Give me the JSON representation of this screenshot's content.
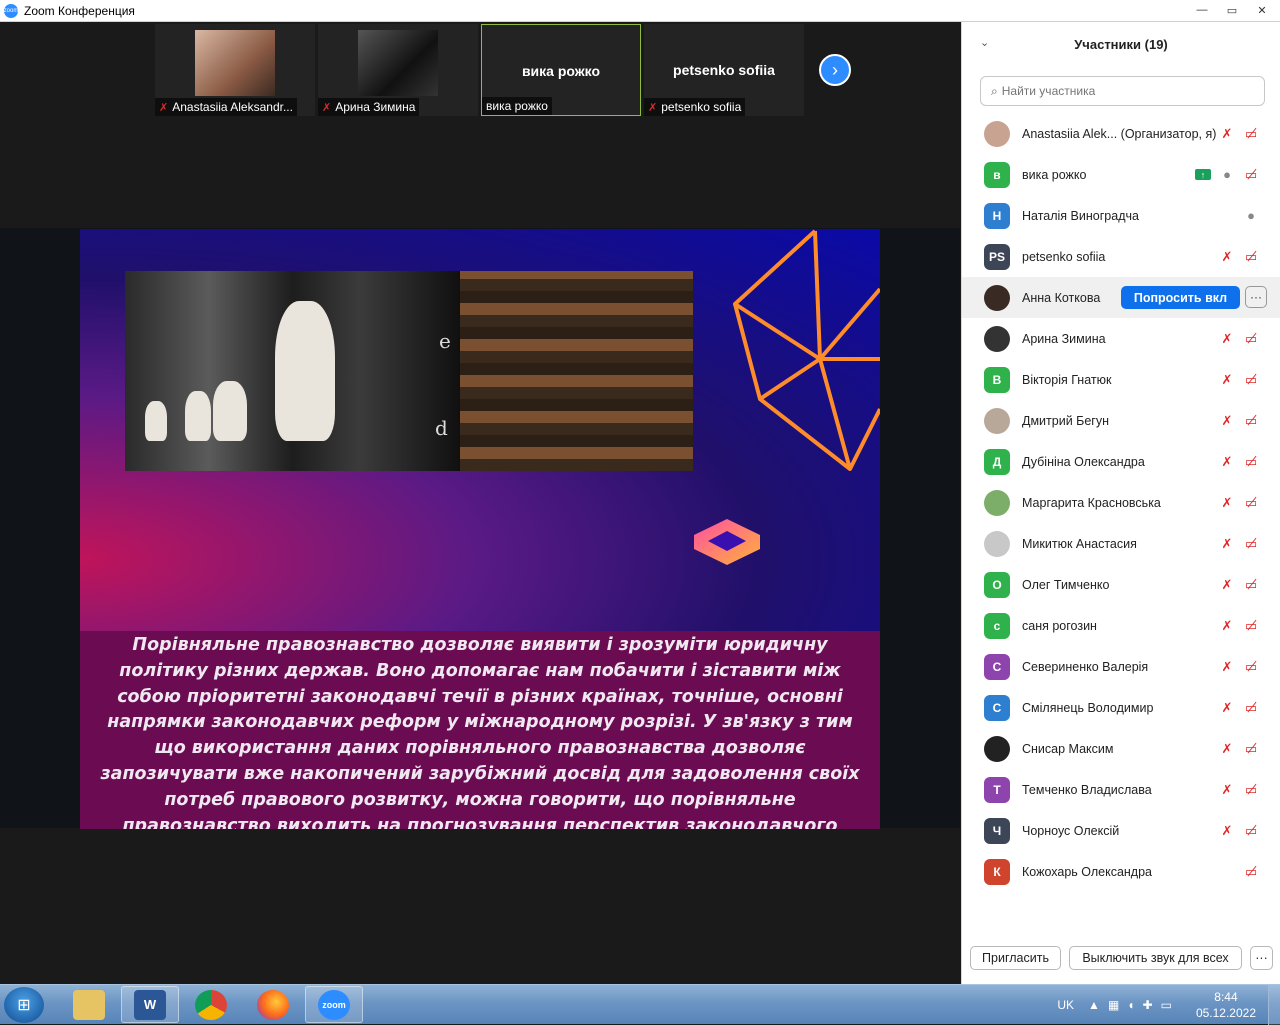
{
  "window": {
    "title": "Zoom Конференция",
    "logo_text": "zoom",
    "min": "—",
    "max": "▭",
    "close": "✕"
  },
  "thumbnails": [
    {
      "label": "Anastasiia Aleksandr...",
      "has_photo": true,
      "muted": true
    },
    {
      "label": "Арина Зимина",
      "has_photo": true,
      "muted": true
    },
    {
      "label": "вика рожко",
      "center_name": "вика рожко",
      "muted": false,
      "active": true
    },
    {
      "label": "petsenko sofiia",
      "center_name": "petsenko sofiia",
      "muted": true
    }
  ],
  "next_arrow": "›",
  "slide": {
    "letters": [
      "e",
      "d"
    ],
    "caption": "Порівняльне правознавство дозволяє виявити і зрозуміти юридичну політику різних держав. Воно допомагає нам побачити і зіставити між собою пріоритетні законодавчі течії в різних країнах, точніше, основні напрямки законодавчих реформ у міжнародному розрізі. У зв'язку з тим що використання даних порівняльного правознавства дозволяє запозичувати вже накопичений зарубіжний досвід для задоволення своїх потреб правового розвитку, можна говорити, що порівняльне правознавство виходить на прогнозування перспектив законодавчого розвитку."
  },
  "panel": {
    "title": "Участники (19)",
    "collapse_icon": "⌄",
    "search_placeholder": "Найти участника",
    "participants": [
      {
        "name": "Anastasiia Alek... (Организатор, я)",
        "avatar": "",
        "color": "#c9a391",
        "photo": true,
        "icons": [
          "mic-off",
          "video-off"
        ]
      },
      {
        "name": "вика рожко",
        "avatar": "в",
        "color": "#2fb24c",
        "icons": [
          "share",
          "mic",
          "video-off"
        ]
      },
      {
        "name": "Наталія Виноградча",
        "avatar": "Н",
        "color": "#2f7fd1",
        "icons": [
          "mic"
        ]
      },
      {
        "name": "petsenko sofiia",
        "avatar": "PS",
        "color": "#3d4657",
        "icons": [
          "mic-off",
          "video-off"
        ]
      },
      {
        "name": "Анна Коткова",
        "avatar": "",
        "color": "#3a2a24",
        "photo": true,
        "icons": [],
        "hover": true
      },
      {
        "name": "Арина Зимина",
        "avatar": "",
        "color": "#333333",
        "photo": true,
        "icons": [
          "mic-off",
          "video-off"
        ]
      },
      {
        "name": "Вікторія Гнатюк",
        "avatar": "В",
        "color": "#2fb24c",
        "icons": [
          "mic-off",
          "video-off"
        ]
      },
      {
        "name": "Дмитрий Бегун",
        "avatar": "",
        "color": "#b8a89a",
        "photo": true,
        "icons": [
          "mic-off",
          "video-off"
        ]
      },
      {
        "name": "Дубініна Олександра",
        "avatar": "Д",
        "color": "#2fb24c",
        "icons": [
          "mic-off",
          "video-off"
        ]
      },
      {
        "name": "Маргарита Красновська",
        "avatar": "",
        "color": "#7cae6a",
        "photo": true,
        "icons": [
          "mic-off",
          "video-off"
        ]
      },
      {
        "name": "Микитюк Анастасия",
        "avatar": "",
        "color": "#c8c8c8",
        "photo": true,
        "icons": [
          "mic-off",
          "video-off"
        ]
      },
      {
        "name": "Олег Тимченко",
        "avatar": "О",
        "color": "#2fb24c",
        "icons": [
          "mic-off",
          "video-off"
        ]
      },
      {
        "name": "саня рогозин",
        "avatar": "с",
        "color": "#2fb24c",
        "icons": [
          "mic-off",
          "video-off"
        ]
      },
      {
        "name": "Севериненко Валерія",
        "avatar": "С",
        "color": "#8e44ad",
        "icons": [
          "mic-off",
          "video-off"
        ]
      },
      {
        "name": "Смілянець Володимир",
        "avatar": "С",
        "color": "#2f7fd1",
        "icons": [
          "mic-off",
          "video-off"
        ]
      },
      {
        "name": "Снисар Максим",
        "avatar": "",
        "color": "#222222",
        "photo": true,
        "icons": [
          "mic-off",
          "video-off"
        ]
      },
      {
        "name": "Темченко Владислава",
        "avatar": "Т",
        "color": "#8e44ad",
        "icons": [
          "mic-off",
          "video-off"
        ]
      },
      {
        "name": "Чорноус Олексій",
        "avatar": "Ч",
        "color": "#3d4657",
        "icons": [
          "mic-off",
          "video-off"
        ]
      },
      {
        "name": "Кожохарь Олександра",
        "avatar": "К",
        "color": "#d0432c",
        "icons": [
          "video-off"
        ]
      }
    ],
    "ask_button": "Попросить вкл",
    "more_button": "···",
    "invite_button": "Пригласить",
    "mute_all_button": "Выключить звук для всех",
    "footer_more": "···"
  },
  "taskbar": {
    "apps": [
      "explorer",
      "W",
      "chrome",
      "firefox",
      "zoom"
    ],
    "lang": "UK",
    "time": "8:44",
    "date": "05.12.2022"
  }
}
